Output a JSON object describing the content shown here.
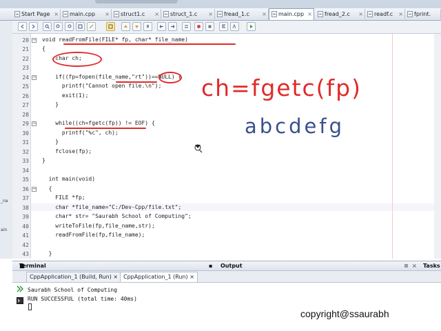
{
  "tabs": [
    {
      "label": "Start Page",
      "active": false
    },
    {
      "label": "main.cpp",
      "active": false
    },
    {
      "label": "struct1.c",
      "active": false
    },
    {
      "label": "struct_1.c",
      "active": false
    },
    {
      "label": "fread_1.c",
      "active": false
    },
    {
      "label": "main.cpp",
      "active": true
    },
    {
      "label": "fread_2.c",
      "active": false
    },
    {
      "label": "readf.c",
      "active": false
    },
    {
      "label": "fprint.",
      "active": false
    }
  ],
  "left_labels": [
    "_na",
    "ain"
  ],
  "editor": {
    "lines": [
      {
        "n": "20",
        "text": "void readFromFile(FILE* fp, char* file_name)",
        "fold": "-"
      },
      {
        "n": "21",
        "text": "{",
        "fold": ""
      },
      {
        "n": "22",
        "text": "    char ch;",
        "fold": ""
      },
      {
        "n": "23",
        "text": "",
        "fold": ""
      },
      {
        "n": "24",
        "text": "    if((fp=fopen(file_name,\"rt\"))==NULL) {",
        "fold": "-"
      },
      {
        "n": "25",
        "text": "      printf(\"Cannot open file.\\n\");",
        "fold": ""
      },
      {
        "n": "26",
        "text": "      exit(1);",
        "fold": ""
      },
      {
        "n": "27",
        "text": "    }",
        "fold": ""
      },
      {
        "n": "28",
        "text": "",
        "fold": ""
      },
      {
        "n": "29",
        "text": "    while((ch=fgetc(fp)) != EOF) {",
        "fold": "-"
      },
      {
        "n": "30",
        "text": "      printf(\"%c\", ch);",
        "fold": ""
      },
      {
        "n": "31",
        "text": "    }",
        "fold": ""
      },
      {
        "n": "32",
        "text": "    fclose(fp);",
        "fold": ""
      },
      {
        "n": "33",
        "text": "}",
        "fold": ""
      },
      {
        "n": "34",
        "text": "",
        "fold": ""
      },
      {
        "n": "35",
        "text": "  int main(void)",
        "fold": ""
      },
      {
        "n": "36",
        "text": "  {",
        "fold": "-"
      },
      {
        "n": "37",
        "text": "    FILE *fp;",
        "fold": ""
      },
      {
        "n": "38",
        "text": "    char *file_name=\"C:/Dev-Cpp/file.txt\";",
        "fold": ""
      },
      {
        "n": "39",
        "text": "    char* str= \"Saurabh School of Computing\";",
        "fold": ""
      },
      {
        "n": "40",
        "text": "    writeToFile(fp,file_name,str);",
        "fold": ""
      },
      {
        "n": "41",
        "text": "    readFromFile(fp,file_name);",
        "fold": ""
      },
      {
        "n": "42",
        "text": "",
        "fold": ""
      },
      {
        "n": "43",
        "text": "  }",
        "fold": ""
      }
    ]
  },
  "annotations": {
    "formula": "ch=fgetc(fp)",
    "chars": "abcdefg"
  },
  "panels": {
    "terminal_label": "Terminal",
    "output_label": "Output",
    "tasks_label": "Tasks"
  },
  "run_tabs": [
    {
      "label": "CppApplication_1 (Build, Run)",
      "active": false
    },
    {
      "label": "CppApplication_1 (Run)",
      "active": true
    }
  ],
  "output_lines": [
    "Saurabh School of Computing",
    "RUN SUCCESSFUL (total time: 40ms)"
  ],
  "copyright": "copyright@ssaurabh",
  "colors": {
    "annotation_red": "#e02a2a",
    "annotation_blue": "#3a4f8d",
    "string_orange": "#c46d26",
    "highlight_yellow": "#fff3a8"
  }
}
